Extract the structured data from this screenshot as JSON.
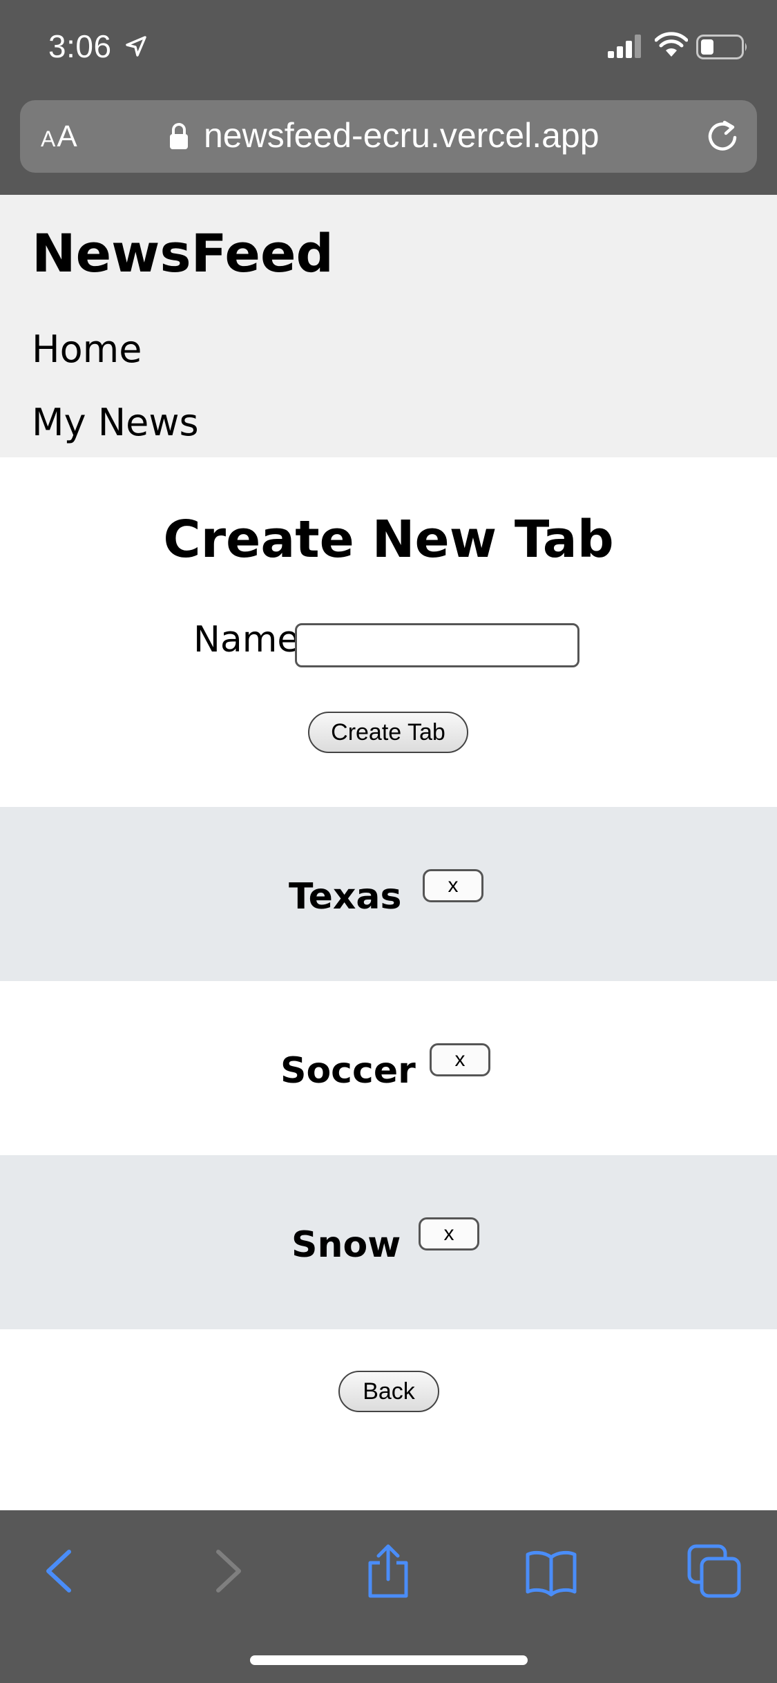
{
  "status_bar": {
    "time": "3:06",
    "icons": [
      "location-arrow-icon",
      "cellular-signal-icon",
      "wifi-icon",
      "battery-icon"
    ]
  },
  "browser": {
    "text_size_button_small": "A",
    "text_size_button_large": "A",
    "url": "newsfeed-ecru.vercel.app",
    "accent_color": "#4a8df8",
    "chrome_color": "#585858"
  },
  "header": {
    "site_title": "NewsFeed",
    "nav": [
      {
        "label": "Home"
      },
      {
        "label": "My News"
      }
    ]
  },
  "form": {
    "heading": "Create New Tab",
    "name_label": "Name",
    "name_value": "",
    "submit_label": "Create Tab"
  },
  "tabs": [
    {
      "name": "Texas",
      "remove_label": "x"
    },
    {
      "name": "Soccer",
      "remove_label": "x"
    },
    {
      "name": "Snow",
      "remove_label": "x"
    }
  ],
  "back_label": "Back",
  "toolbar": {
    "icons": [
      "back-arrow-icon",
      "forward-arrow-icon",
      "share-icon",
      "bookmarks-icon",
      "tabs-icon"
    ]
  }
}
